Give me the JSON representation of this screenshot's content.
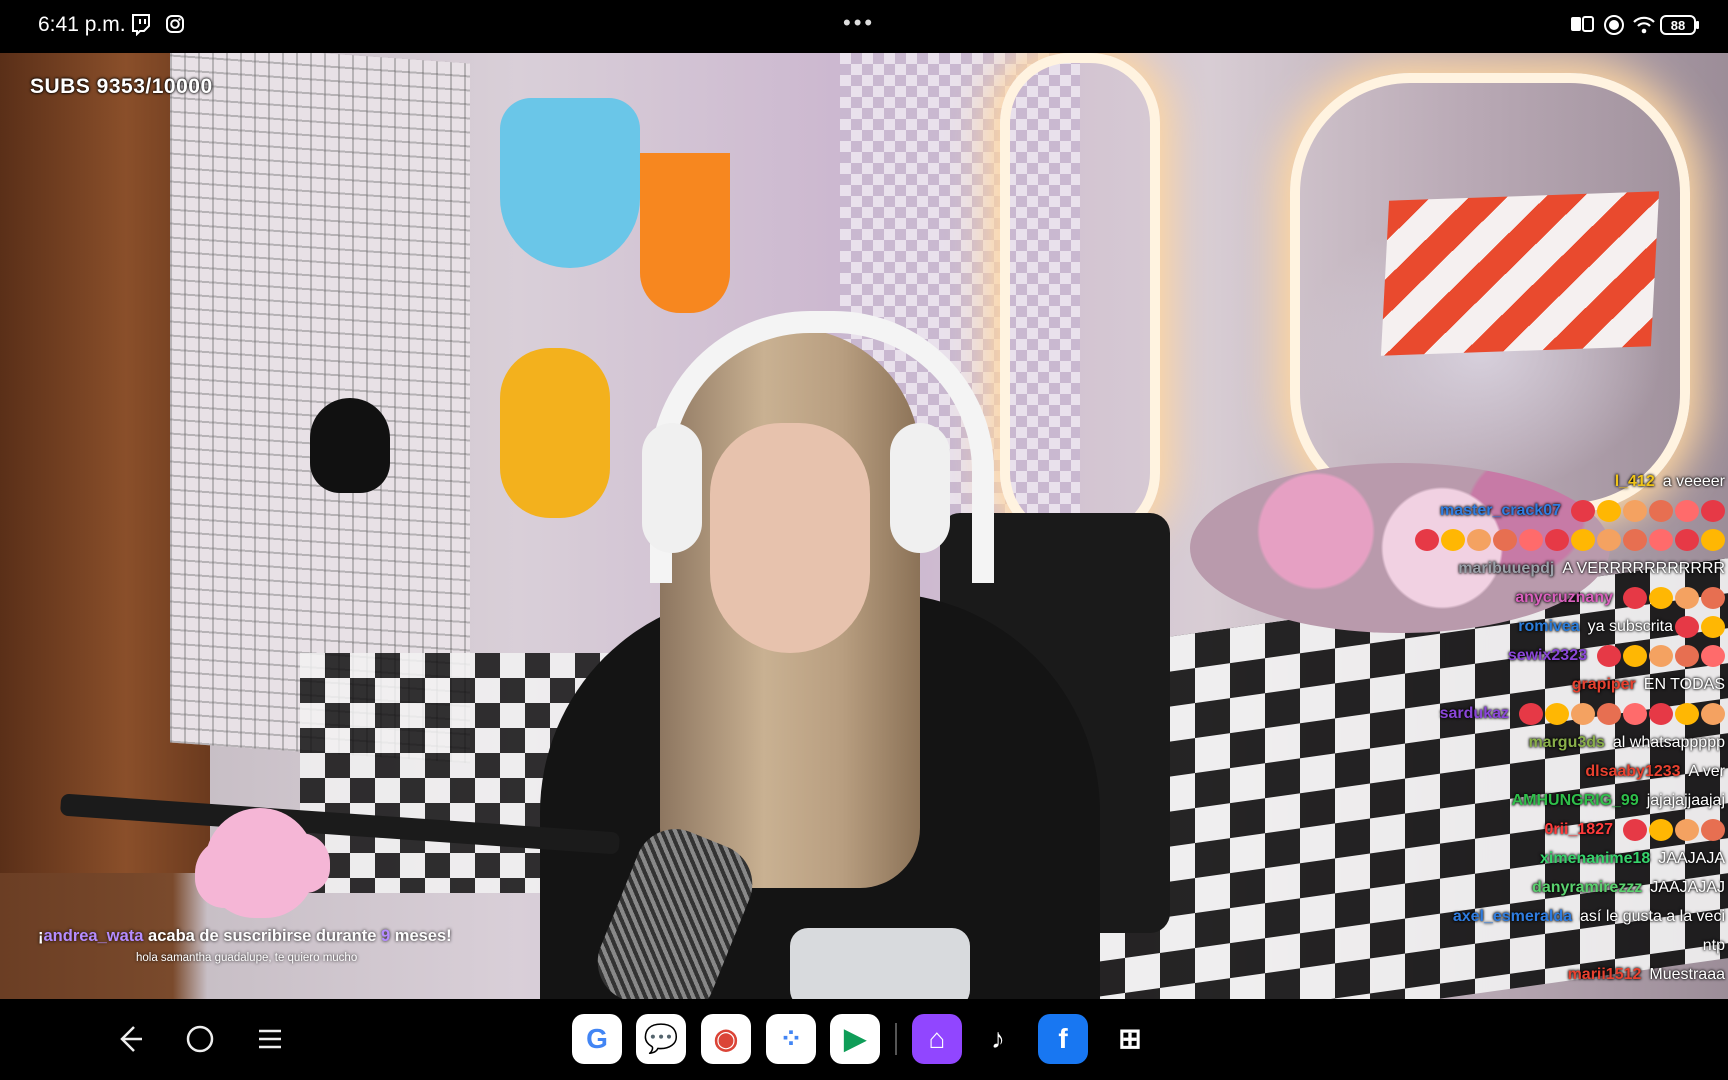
{
  "status_bar": {
    "time": "6:41 p.m.",
    "battery": "88",
    "colors": {
      "bg": "#000000",
      "text": "#ffffff"
    },
    "icons": [
      "twitch-icon",
      "instagram-icon",
      "more-dots-icon",
      "reading-mode-icon",
      "record-icon",
      "wifi-icon",
      "battery-icon"
    ]
  },
  "stream": {
    "subs_goal": "SUBS 9353/10000",
    "alert": {
      "prefix": "¡",
      "username": "andrea_wata",
      "text_1": " acaba de suscribirse durante ",
      "months": "9",
      "text_2": " meses!",
      "message": "hola samantha guadalupe, te quiero mucho"
    },
    "chat": [
      {
        "user": "l_412",
        "text": "a veeeer",
        "color": "#f0c419"
      },
      {
        "user": "master_crack07",
        "text": "",
        "color": "#2f7de1",
        "emotes": 6
      },
      {
        "user": "",
        "text": "",
        "color": "#ffffff",
        "emotes": 12
      },
      {
        "user": "maribuuepdj",
        "text": "A VERRRRRRRRRRR",
        "color": "#9aa0a8"
      },
      {
        "user": "anycruznany",
        "text": "",
        "color": "#d95fbd",
        "emotes": 4
      },
      {
        "user": "romivea",
        "text": "ya subscrita",
        "color": "#2a7ddc",
        "emotes": 2
      },
      {
        "user": "sewix2323",
        "text": "",
        "color": "#8a46d8",
        "emotes": 5
      },
      {
        "user": "grapiper",
        "text": "EN TODAS",
        "color": "#e8412f"
      },
      {
        "user": "sardukaz",
        "text": "",
        "color": "#8a46d8",
        "emotes": 8
      },
      {
        "user": "margu3ds",
        "text": "al whatsappppp",
        "color": "#8ab04a"
      },
      {
        "user": "dlsaaby1233",
        "text": "A ver",
        "color": "#e8412f"
      },
      {
        "user": "AMHUNGRIG_99",
        "text": "jajajajjaajaj",
        "color": "#2fbf4a"
      },
      {
        "user": "0rii_1827",
        "text": "",
        "color": "#ff3b3b",
        "emotes": 4
      },
      {
        "user": "ximenanime18",
        "text": "JAAJAJA",
        "color": "#36d36b"
      },
      {
        "user": "danyramirezzz",
        "text": "JAAJAJAJ",
        "color": "#5ad26e"
      },
      {
        "user": "axel_esmeralda",
        "text": "así le gusta a la veci",
        "color": "#2f7de1"
      },
      {
        "user": "",
        "text": "ntp",
        "color": "#ffffff"
      },
      {
        "user": "marii1512",
        "text": "Muestraaa",
        "color": "#e8412f"
      }
    ]
  },
  "nav_bar": {
    "buttons": [
      "back-icon",
      "home-icon",
      "recents-icon"
    ],
    "apps": [
      {
        "name": "google",
        "glyph": "G",
        "bg": "#ffffff",
        "fg": "#4285f4"
      },
      {
        "name": "messages",
        "glyph": "💬",
        "bg": "#ffffff",
        "fg": "#1a73e8"
      },
      {
        "name": "chrome",
        "glyph": "◉",
        "bg": "#ffffff",
        "fg": "#db4437"
      },
      {
        "name": "assistant",
        "glyph": "⁘",
        "bg": "#ffffff",
        "fg": "#4285f4"
      },
      {
        "name": "play-store",
        "glyph": "▶",
        "bg": "#ffffff",
        "fg": "#0f9d58"
      },
      {
        "name": "twitch",
        "glyph": "⌂",
        "bg": "#9146ff",
        "fg": "#ffffff"
      },
      {
        "name": "tiktok",
        "glyph": "♪",
        "bg": "#000000",
        "fg": "#ffffff"
      },
      {
        "name": "facebook",
        "glyph": "f",
        "bg": "#1877f2",
        "fg": "#ffffff"
      },
      {
        "name": "qr-scanner",
        "glyph": "⊞",
        "bg": "#000000",
        "fg": "#ffffff"
      }
    ]
  }
}
